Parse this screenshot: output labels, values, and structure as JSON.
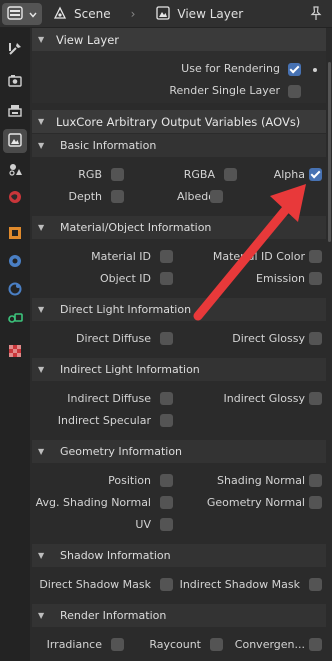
{
  "header": {
    "scene_label": "Scene",
    "separator": "›",
    "view_layer_label": "View Layer"
  },
  "view_layer": {
    "title": "View Layer",
    "use_for_rendering": {
      "label": "Use for Rendering",
      "checked": true
    },
    "render_single_layer": {
      "label": "Render Single Layer",
      "checked": false
    }
  },
  "aovs": {
    "title": "LuxCore Arbitrary Output Variables (AOVs)",
    "sections": [
      {
        "title": "Basic Information",
        "items": [
          {
            "label": "RGB",
            "checked": false
          },
          {
            "label": "RGBA",
            "checked": false
          },
          {
            "label": "Alpha",
            "checked": true
          },
          {
            "label": "Depth",
            "checked": false
          },
          {
            "label": "Albedo",
            "checked": false
          }
        ]
      },
      {
        "title": "Material/Object Information",
        "items": [
          {
            "label": "Material ID",
            "checked": false
          },
          {
            "label": "Material ID Color",
            "checked": false
          },
          {
            "label": "Object ID",
            "checked": false
          },
          {
            "label": "Emission",
            "checked": false
          }
        ]
      },
      {
        "title": "Direct Light Information",
        "items": [
          {
            "label": "Direct Diffuse",
            "checked": false
          },
          {
            "label": "Direct Glossy",
            "checked": false
          }
        ]
      },
      {
        "title": "Indirect Light Information",
        "items": [
          {
            "label": "Indirect Diffuse",
            "checked": false
          },
          {
            "label": "Indirect Glossy",
            "checked": false
          },
          {
            "label": "Indirect Specular",
            "checked": false
          }
        ]
      },
      {
        "title": "Geometry Information",
        "items": [
          {
            "label": "Position",
            "checked": false
          },
          {
            "label": "Shading Normal",
            "checked": false
          },
          {
            "label": "Avg. Shading Normal",
            "checked": false
          },
          {
            "label": "Geometry Normal",
            "checked": false
          },
          {
            "label": "UV",
            "checked": false
          }
        ]
      },
      {
        "title": "Shadow Information",
        "items": [
          {
            "label": "Direct Shadow Mask",
            "checked": false
          },
          {
            "label": "Indirect Shadow Mask",
            "checked": false
          }
        ]
      },
      {
        "title": "Render Information",
        "items": [
          {
            "label": "Irradiance",
            "checked": false
          },
          {
            "label": "Raycount",
            "checked": false
          },
          {
            "label": "Convergen...",
            "checked": false
          }
        ]
      }
    ]
  },
  "colors": {
    "accent": "#4772b3",
    "annotation_arrow": "#e8393a"
  },
  "icons": {
    "editor": "properties-editor-icon",
    "scene": "scene-icon",
    "view_layer": "view-layer-icon",
    "pin": "pin-icon",
    "tabs": [
      "tool-icon",
      "render-icon",
      "output-icon",
      "view-layer-icon",
      "scene-icon",
      "world-icon",
      "object-icon",
      "modifier-icon",
      "particles-icon",
      "physics-icon",
      "texture-icon"
    ]
  }
}
